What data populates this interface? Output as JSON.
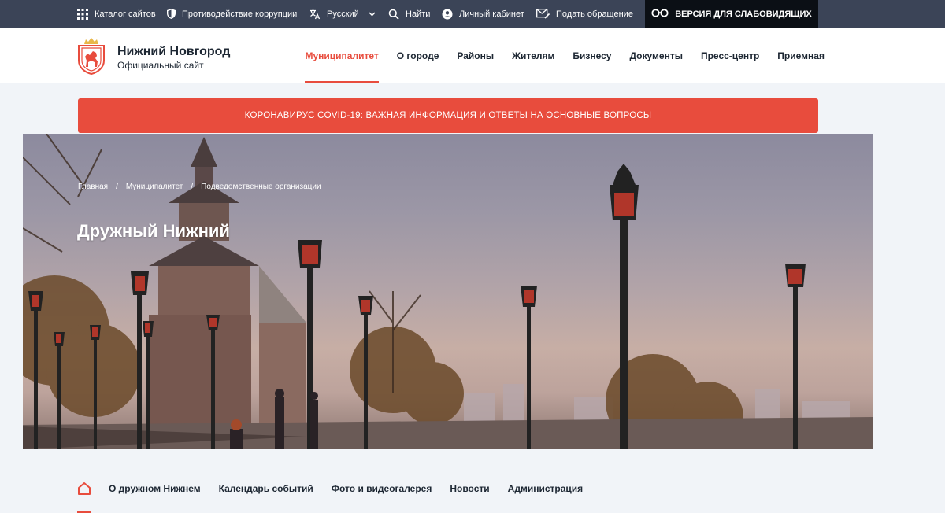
{
  "topbar": {
    "items": [
      {
        "label": "Каталог сайтов",
        "icon": "grid-icon"
      },
      {
        "label": "Противодействие коррупции",
        "icon": "shield-icon"
      },
      {
        "label": "Русский",
        "icon": "translate-icon"
      },
      {
        "label": "Найти",
        "icon": "search-icon"
      },
      {
        "label": "Личный кабинет",
        "icon": "user-icon"
      },
      {
        "label": "Подать обращение",
        "icon": "mail-icon"
      }
    ],
    "vision_button": "ВЕРСИЯ ДЛЯ СЛАБОВИДЯЩИХ"
  },
  "header": {
    "title": "Нижний Новгород",
    "subtitle": "Официальный сайт",
    "nav": [
      {
        "label": "Муниципалитет",
        "active": true
      },
      {
        "label": "О городе"
      },
      {
        "label": "Районы"
      },
      {
        "label": "Жителям"
      },
      {
        "label": "Бизнесу"
      },
      {
        "label": "Документы"
      },
      {
        "label": "Пресс-центр"
      },
      {
        "label": "Приемная"
      }
    ]
  },
  "banner": {
    "text": "КОРОНАВИРУС COVID-19: ВАЖНАЯ ИНФОРМАЦИЯ И ОТВЕТЫ НА ОСНОВНЫЕ ВОПРОСЫ"
  },
  "hero": {
    "breadcrumb": [
      "Главная",
      "Муниципалитет",
      "Подведомственные организации"
    ],
    "breadcrumb_separator": "/",
    "title": "Дружный Нижний"
  },
  "subnav": {
    "items": [
      "О дружном Нижнем",
      "Календарь событий",
      "Фото и видеогалерея",
      "Новости",
      "Администрация"
    ]
  },
  "colors": {
    "accent": "#e84c3d",
    "topbar": "#3b4457",
    "vision": "#0b0f15",
    "text": "#1d2733",
    "page_bg": "#f1f4f8"
  }
}
